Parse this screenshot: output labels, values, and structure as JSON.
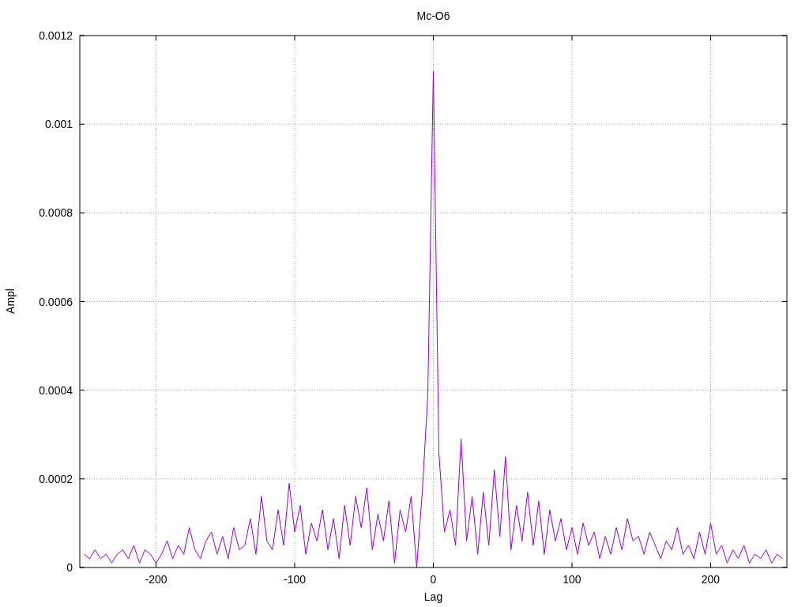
{
  "chart_data": {
    "type": "line",
    "title": "Mc-O6",
    "xlabel": "Lag",
    "ylabel": "Ampl",
    "grid": true,
    "xlim": [
      -255,
      255
    ],
    "ylim": [
      0,
      0.0012
    ],
    "xticks": [
      {
        "value": -200,
        "label": "-200"
      },
      {
        "value": -100,
        "label": "-100"
      },
      {
        "value": 0,
        "label": "0"
      },
      {
        "value": 100,
        "label": "100"
      },
      {
        "value": 200,
        "label": "200"
      }
    ],
    "yticks": [
      {
        "value": 0,
        "label": "0"
      },
      {
        "value": 0.0002,
        "label": "0.0002"
      },
      {
        "value": 0.0004,
        "label": "0.0004"
      },
      {
        "value": 0.0006,
        "label": "0.0006"
      },
      {
        "value": 0.0008,
        "label": "0.0008"
      },
      {
        "value": 0.001,
        "label": "0.001"
      },
      {
        "value": 0.0012,
        "label": "0.0012"
      }
    ],
    "x": [
      -252,
      -248,
      -244,
      -240,
      -236,
      -232,
      -228,
      -224,
      -220,
      -216,
      -212,
      -208,
      -204,
      -200,
      -196,
      -192,
      -188,
      -184,
      -180,
      -176,
      -172,
      -168,
      -164,
      -160,
      -156,
      -152,
      -148,
      -144,
      -140,
      -136,
      -132,
      -128,
      -124,
      -120,
      -116,
      -112,
      -108,
      -104,
      -100,
      -96,
      -92,
      -88,
      -84,
      -80,
      -76,
      -72,
      -68,
      -64,
      -60,
      -56,
      -52,
      -48,
      -44,
      -40,
      -36,
      -32,
      -28,
      -24,
      -20,
      -16,
      -12,
      -8,
      -4,
      0,
      4,
      8,
      12,
      16,
      20,
      24,
      28,
      32,
      36,
      40,
      44,
      48,
      52,
      56,
      60,
      64,
      68,
      72,
      76,
      80,
      84,
      88,
      92,
      96,
      100,
      104,
      108,
      112,
      116,
      120,
      124,
      128,
      132,
      136,
      140,
      144,
      148,
      152,
      156,
      160,
      164,
      168,
      172,
      176,
      180,
      184,
      188,
      192,
      196,
      200,
      204,
      208,
      212,
      216,
      220,
      224,
      228,
      232,
      236,
      240,
      244,
      248,
      252
    ],
    "series": [
      {
        "color": "#9400d3",
        "values": [
          3e-05,
          2e-05,
          4e-05,
          2e-05,
          3e-05,
          1e-05,
          3e-05,
          4e-05,
          2e-05,
          5e-05,
          1e-05,
          4e-05,
          3e-05,
          1e-05,
          3e-05,
          6e-05,
          2e-05,
          5e-05,
          3e-05,
          9e-05,
          4e-05,
          2e-05,
          6e-05,
          8e-05,
          3e-05,
          7e-05,
          2e-05,
          9e-05,
          4e-05,
          5e-05,
          0.00011,
          3e-05,
          0.00016,
          6e-05,
          4e-05,
          0.00013,
          5e-05,
          0.00019,
          8e-05,
          0.00014,
          3e-05,
          0.0001,
          6e-05,
          0.00013,
          4e-05,
          0.00011,
          2e-05,
          0.00014,
          5e-05,
          0.00016,
          9e-05,
          0.00018,
          4e-05,
          0.00012,
          6e-05,
          0.00015,
          1e-05,
          0.00013,
          8e-05,
          0.00016,
          0.0,
          0.00017,
          0.00039,
          0.00112,
          0.00026,
          8e-05,
          0.00013,
          5e-05,
          0.00029,
          6e-05,
          0.00016,
          3e-05,
          0.00017,
          5e-05,
          0.00022,
          7e-05,
          0.00025,
          4e-05,
          0.00014,
          6e-05,
          0.00017,
          5e-05,
          0.00015,
          3e-05,
          0.00013,
          6e-05,
          0.00011,
          4e-05,
          9e-05,
          3e-05,
          0.0001,
          5e-05,
          8e-05,
          2e-05,
          7e-05,
          3e-05,
          9e-05,
          4e-05,
          0.00011,
          6e-05,
          7e-05,
          3e-05,
          8e-05,
          5e-05,
          2e-05,
          6e-05,
          4e-05,
          9e-05,
          3e-05,
          5e-05,
          2e-05,
          8e-05,
          3e-05,
          0.0001,
          3e-05,
          5e-05,
          1e-05,
          4e-05,
          2e-05,
          5e-05,
          1e-05,
          3e-05,
          2e-05,
          4e-05,
          1e-05,
          3e-05,
          2e-05
        ]
      }
    ]
  }
}
